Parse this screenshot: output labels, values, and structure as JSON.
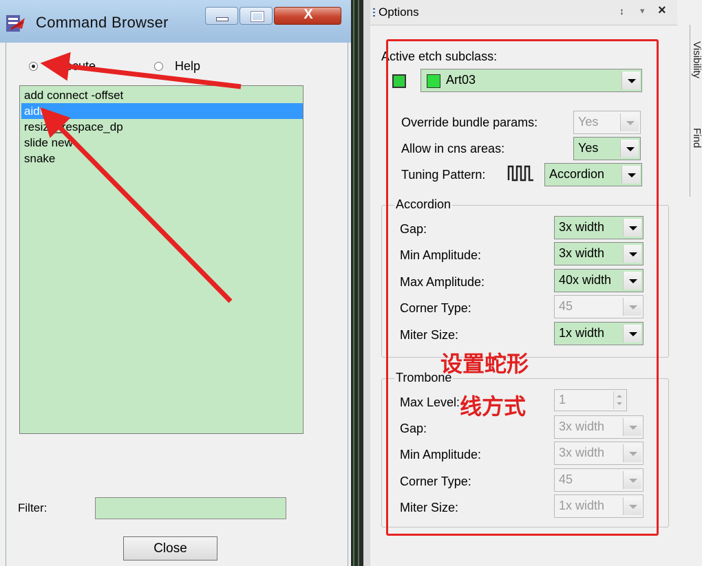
{
  "command_browser": {
    "title": "Command Browser",
    "close_glyph": "X",
    "mode_options": [
      {
        "label": "Execute",
        "selected": true
      },
      {
        "label": "Help",
        "selected": false
      }
    ],
    "commands": [
      "add connect -offset",
      "aidt",
      "resize_respace_dp",
      "slide new",
      "snake"
    ],
    "selected_command": "aidt",
    "filter_label": "Filter:",
    "filter_value": "",
    "close_button": "Close"
  },
  "options": {
    "title": "Options",
    "pin_glyph": "↕",
    "menu_glyph": "▾",
    "close_glyph": "×",
    "side_tabs": [
      "Visibility",
      "Find"
    ],
    "active_etch_label": "Active etch subclass:",
    "active_etch_value": "Art03",
    "active_etch_color": "#2fdc3f",
    "override_bundle_label": "Override bundle params:",
    "override_bundle_value": "Yes",
    "allow_cns_label": "Allow in cns areas:",
    "allow_cns_value": "Yes",
    "tuning_pattern_label": "Tuning Pattern:",
    "tuning_pattern_value": "Accordion",
    "accordion": {
      "title": "Accordion",
      "gap_label": "Gap:",
      "gap_value": "3x width",
      "min_amp_label": "Min Amplitude:",
      "min_amp_value": "3x width",
      "max_amp_label": "Max Amplitude:",
      "max_amp_value": "40x width",
      "corner_label": "Corner Type:",
      "corner_value": "45",
      "miter_label": "Miter Size:",
      "miter_value": "1x width"
    },
    "trombone": {
      "title": "Trombone",
      "max_level_label": "Max Level:",
      "max_level_value": "1",
      "gap_label": "Gap:",
      "gap_value": "3x width",
      "min_amp_label": "Min Amplitude:",
      "min_amp_value": "3x width",
      "corner_label": "Corner Type:",
      "corner_value": "45",
      "miter_label": "Miter Size:",
      "miter_value": "1x width"
    }
  },
  "annotation": {
    "line1": "设置蛇形",
    "line2": "线方式",
    "color": "#e62222"
  }
}
